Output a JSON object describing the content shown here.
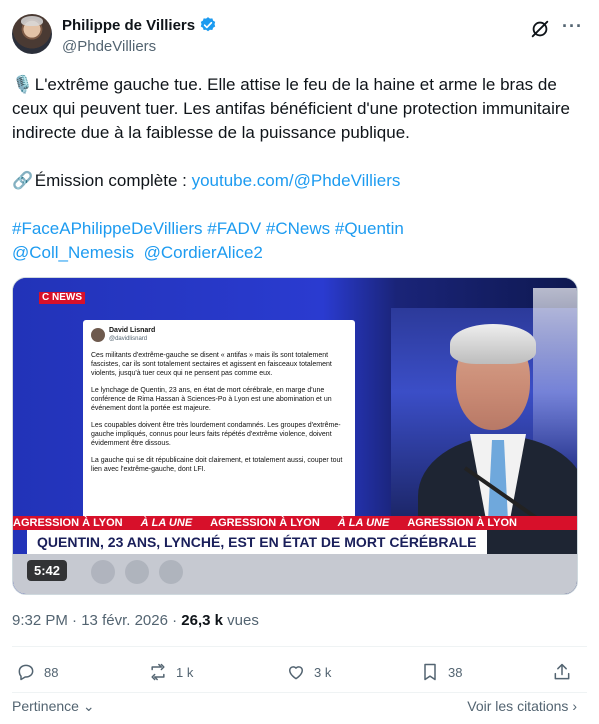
{
  "author": {
    "name": "Philippe de Villiers",
    "handle": "@PhdeVilliers"
  },
  "tweet": {
    "emoji_mic": "🎙️",
    "line1": "L'extrême gauche tue. Elle attise le feu de la haine et arme le bras de ceux qui peuvent tuer. Les antifas bénéficient d'une protection immunitaire indirecte due à la faiblesse de la puissance publique.",
    "emoji_link": "🔗",
    "emission_label": "Émission complète : ",
    "emission_link": "youtube.com/@PhdeVilliers",
    "hashtags": [
      "#FaceAPhilippeDeVilliers",
      "#FADV",
      "#CNews",
      "#Quentin"
    ],
    "mentions": [
      "@Coll_Nemesis",
      "@CordierAlice2"
    ]
  },
  "media": {
    "channel_label_c": "C",
    "channel_label_news": "NEWS",
    "embedded_post": {
      "name": "David Lisnard",
      "handle": "@davidlisnard",
      "p1": "Ces militants d'extrême-gauche se disent « antifas » mais ils sont totalement fascistes, car ils sont totalement sectaires et agissent en faisceaux totalement violents, jusqu'à tuer ceux qui ne pensent pas comme eux.",
      "p2": "Le lynchage de Quentin, 23 ans, en état de mort cérébrale, en marge d'une conférence de Rima Hassan à Sciences-Po à Lyon est une abomination et un événement dont la portée est majeure.",
      "p3": "Les coupables doivent être très lourdement condamnés. Les groupes d'extrême-gauche impliqués, connus pour leurs faits répétés d'extrême violence, doivent évidemment être dissous.",
      "p4": "La gauche qui se dit républicaine doit clairement, et totalement aussi, couper tout lien avec l'extrême-gauche, dont LFI."
    },
    "ticker": [
      "AGRESSION À LYON",
      "À LA UNE",
      "AGRESSION À LYON",
      "À LA UNE",
      "AGRESSION À LYON"
    ],
    "headline": "QUENTIN, 23 ANS, LYNCHÉ, EST EN ÉTAT DE MORT CÉRÉBRALE",
    "duration": "5:42"
  },
  "meta": {
    "time": "9:32 PM",
    "separator": " · ",
    "date": "13 févr. 2026",
    "dot": " · ",
    "views_count": "26,3 k",
    "views_label": " vues"
  },
  "actions": {
    "replies": "88",
    "reposts": "1 k",
    "likes": "3 k",
    "bookmarks": "38"
  },
  "footer": {
    "left": "Pertinence",
    "right": "Voir les citations"
  },
  "colors": {
    "link": "#1d9bf0",
    "secondary_text": "#536471",
    "verified": "#1d9bf0"
  }
}
